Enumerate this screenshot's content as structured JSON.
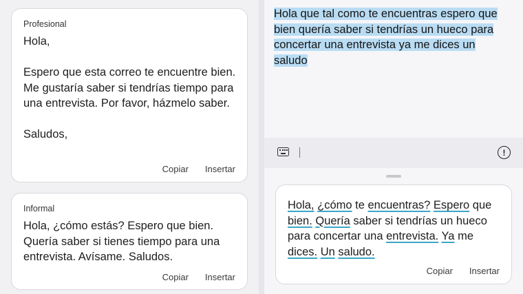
{
  "suggestions": {
    "professional": {
      "label": "Profesional",
      "text": "Hola,\n\nEspero que esta correo te encuentre bien. Me gustaría saber si tendrías tiempo para una entrevista. Por favor, házmelo saber.\n\nSaludos,",
      "copy_label": "Copiar",
      "insert_label": "Insertar"
    },
    "informal": {
      "label": "Informal",
      "text": "Hola, ¿cómo estás? Espero que bien. Quería saber si tienes tiempo para una entrevista. Avísame. Saludos.",
      "copy_label": "Copiar",
      "insert_label": "Insertar"
    }
  },
  "input": {
    "selected_text": "Hola que tal como te encuentras espero que bien quería saber si tendrías un hueco para concertar una entrevista ya me dices un saludo"
  },
  "toolbar": {
    "keyboard_icon": "keyboard-icon",
    "info_icon": "info-icon",
    "info_glyph": "!"
  },
  "correction": {
    "segments": [
      {
        "text": "Hola,",
        "fix": true
      },
      {
        "text": " ",
        "fix": false
      },
      {
        "text": "¿cómo",
        "fix": true
      },
      {
        "text": " te ",
        "fix": false
      },
      {
        "text": "encuentras?",
        "fix": true
      },
      {
        "text": " ",
        "fix": false
      },
      {
        "text": "Espero",
        "fix": true
      },
      {
        "text": " que ",
        "fix": false
      },
      {
        "text": "bien.",
        "fix": true
      },
      {
        "text": " ",
        "fix": false
      },
      {
        "text": "Quería",
        "fix": true
      },
      {
        "text": " saber si tendrías un hueco para concertar una ",
        "fix": false
      },
      {
        "text": "entrevista.",
        "fix": true
      },
      {
        "text": " ",
        "fix": false
      },
      {
        "text": "Ya",
        "fix": true
      },
      {
        "text": " me ",
        "fix": false
      },
      {
        "text": "dices.",
        "fix": true
      },
      {
        "text": " ",
        "fix": false
      },
      {
        "text": "Un",
        "fix": true
      },
      {
        "text": " ",
        "fix": false
      },
      {
        "text": "saludo.",
        "fix": true
      }
    ],
    "copy_label": "Copiar",
    "insert_label": "Insertar"
  },
  "colors": {
    "highlight": "#b9dcf3",
    "underline": "#3ba6c8"
  }
}
